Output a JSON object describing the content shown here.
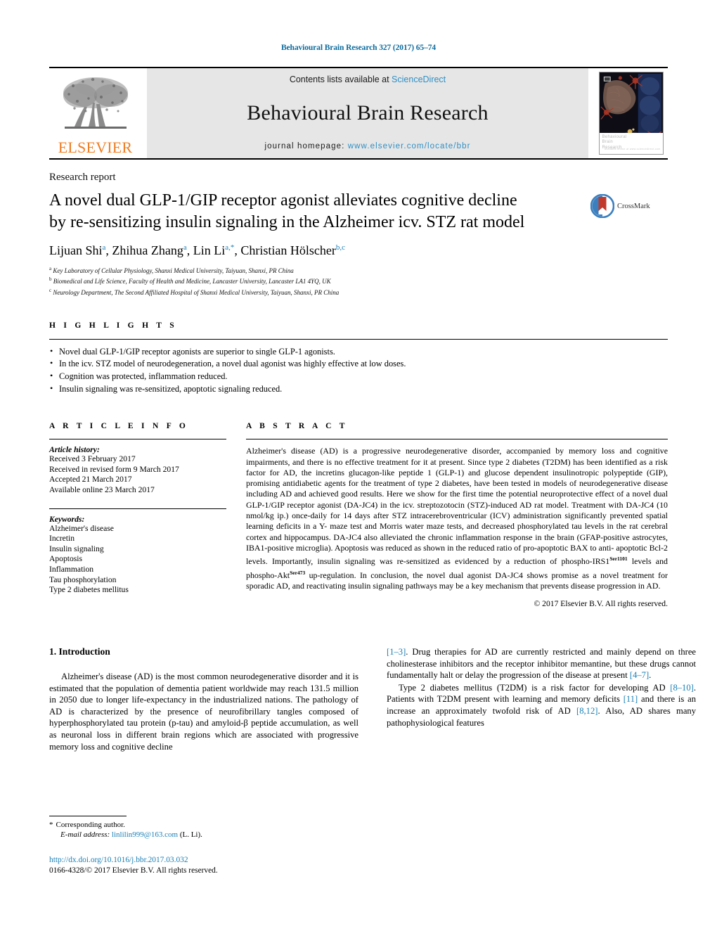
{
  "running_head": "Behavioural Brain Research 327 (2017) 65–74",
  "masthead": {
    "publisher_name": "ELSEVIER",
    "contents_prefix": "Contents lists available at ",
    "contents_link": "ScienceDirect",
    "journal_name": "Behavioural Brain Research",
    "homepage_prefix": "journal homepage: ",
    "homepage_url": "www.elsevier.com/locate/bbr",
    "cover_caption_line1": "Behavioural",
    "cover_caption_line2": "Brain",
    "cover_caption_line3": "Research",
    "cover_caption_tiny": "available online at www.sciencedirect.com"
  },
  "article": {
    "type": "Research report",
    "title_line1": "A novel dual GLP-1/GIP receptor agonist alleviates cognitive decline",
    "title_line2": "by re-sensitizing insulin signaling in the Alzheimer icv. STZ rat model",
    "crossmark_label": "CrossMark",
    "authors": [
      {
        "name": "Lijuan Shi",
        "marks": "a",
        "sep": ", "
      },
      {
        "name": "Zhihua Zhang",
        "marks": "a",
        "sep": ", "
      },
      {
        "name": "Lin Li",
        "marks": "a,*",
        "sep": ", "
      },
      {
        "name": "Christian Hölscher",
        "marks": "b,c",
        "sep": ""
      }
    ],
    "affiliations": [
      {
        "mark": "a",
        "text": "Key Laboratory of Cellular Physiology, Shanxi Medical University, Taiyuan, Shanxi, PR China"
      },
      {
        "mark": "b",
        "text": "Biomedical and Life Science, Faculty of Health and Medicine, Lancaster University, Lancaster LA1 4YQ, UK"
      },
      {
        "mark": "c",
        "text": "Neurology Department, The Second Affiliated Hospital of Shanxi Medical University, Taiyuan, Shanxi, PR China"
      }
    ]
  },
  "highlights": {
    "heading": "H I G H L I G H T S",
    "items": [
      "Novel dual GLP-1/GIP receptor agonists are superior to single GLP-1 agonists.",
      "In the icv. STZ model of neurodegeneration, a novel dual agonist was highly effective at low doses.",
      "Cognition was protected, inflammation reduced.",
      "Insulin signaling was re-sensitized, apoptotic signaling reduced."
    ]
  },
  "article_info": {
    "heading": "A R T I C L E   I N F O",
    "history_label": "Article history:",
    "history": [
      "Received 3 February 2017",
      "Received in revised form 9 March 2017",
      "Accepted 21 March 2017",
      "Available online 23 March 2017"
    ],
    "keywords_label": "Keywords:",
    "keywords": [
      "Alzheimer's disease",
      "Incretin",
      "Insulin signaling",
      "Apoptosis",
      "Inflammation",
      "Tau phosphorylation",
      "Type 2 diabetes mellitus"
    ]
  },
  "abstract": {
    "heading": "A B S T R A C T",
    "part1": "Alzheimer's disease (AD) is a progressive neurodegenerative disorder, accompanied by memory loss and cognitive impairments, and there is no effective treatment for it at present. Since type 2 diabetes (T2DM) has been identified as a risk factor for AD, the incretins glucagon-like peptide 1 (GLP-1) and glucose dependent insulinotropic polypeptide (GIP), promising antidiabetic agents for the treatment of type 2 diabetes, have been tested in models of neurodegenerative disease including AD and achieved good results. Here we show for the first time the potential neuroprotective effect of a novel dual GLP-1/GIP receptor agonist (DA-JC4) in the icv. streptozotocin (STZ)-induced AD rat model. Treatment with DA-JC4 (10 nmol/kg ip.) once-daily for 14 days after STZ intracerebroventricular (ICV) administration significantly prevented spatial learning deficits in a Y- maze test and Morris water maze tests, and decreased phosphorylated tau levels in the rat cerebral cortex and hippocampus. DA-JC4 also alleviated the chronic inflammation response in the brain (GFAP-positive astrocytes, IBA1-positive microglia). Apoptosis was reduced as shown in the reduced ratio of pro-apoptotic BAX to anti- apoptotic Bcl-2 levels. Importantly, insulin signaling was re-sensitized as evidenced by a reduction of phospho-IRS1",
    "sup1": "Ser1101",
    "part2": " levels and phospho-Akt",
    "sup2": "Ser473",
    "part3": " up-regulation. In conclusion, the novel dual agonist DA-JC4 shows promise as a novel treatment for sporadic AD, and reactivating insulin signaling pathways may be a key mechanism that prevents disease progression in AD.",
    "copyright": "© 2017 Elsevier B.V. All rights reserved."
  },
  "introduction": {
    "heading": "1.  Introduction",
    "para1_a": "Alzheimer's disease (AD) is the most common neurodegenerative disorder and it is estimated that the population of dementia patient worldwide may reach 131.5 million in 2050 due to longer life-expectancy in the industrialized nations. The pathology of AD is characterized by the presence of neurofibrillary tangles composed of hyperphosphorylated tau protein (p-tau) and amyloid-β peptide accumulation, as well as neuronal loss in different brain regions which are associated with progressive memory loss and cognitive decline ",
    "ref1": "[1–3]",
    "para1_b": ". Drug therapies for AD are currently restricted and mainly depend on three cholinesterase inhibitors and the receptor inhibitor memantine, but these drugs cannot fundamentally halt or delay the progression of the disease at present ",
    "ref2": "[4–7]",
    "para1_c": ".",
    "para2_a": "Type 2 diabetes mellitus (T2DM) is a risk factor for developing AD ",
    "ref3": "[8–10]",
    "para2_b": ". Patients with T2DM present with learning and memory deficits ",
    "ref4": "[11]",
    "para2_c": " and there is an increase an approximately twofold risk of AD ",
    "ref5": "[8,12]",
    "para2_d": ". Also, AD shares many pathophysiological features"
  },
  "footnotes": {
    "corresponding_star": "*",
    "corresponding_label": "Corresponding author.",
    "email_label": "E-mail address:",
    "email": "linlilin999@163.com",
    "email_suffix": " (L. Li).",
    "doi": "http://dx.doi.org/10.1016/j.bbr.2017.03.032",
    "issn_line": "0166-4328/© 2017 Elsevier B.V. All rights reserved."
  },
  "colors": {
    "link": "#1a7fb5",
    "elsevier_orange": "#ef7d22",
    "masthead_bg": "#e6e6e6"
  }
}
